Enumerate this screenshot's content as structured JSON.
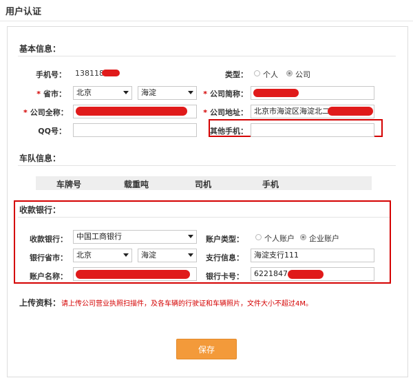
{
  "page": {
    "title": "用户认证"
  },
  "basic": {
    "title": "基本信息：",
    "phone": {
      "label": "手机号：",
      "value": "138118"
    },
    "type": {
      "label": "类型：",
      "options": [
        "个人",
        "公司"
      ],
      "selected": "公司"
    },
    "province": {
      "label": "省市：",
      "province": "北京",
      "city": "海淀"
    },
    "company_short": {
      "label": "公司简称："
    },
    "company_full": {
      "label": "公司全称："
    },
    "company_address": {
      "label": "公司地址：",
      "value": "北京市海淀区海淀北二"
    },
    "qq": {
      "label": "QQ号：",
      "value": ""
    },
    "other_phone": {
      "label": "其他手机：",
      "value": ""
    }
  },
  "fleet": {
    "title": "车队信息：",
    "columns": [
      "车牌号",
      "载重吨",
      "司机",
      "手机"
    ]
  },
  "bank": {
    "title": "收款银行：",
    "bank": {
      "label": "收款银行：",
      "value": "中国工商银行"
    },
    "account_type": {
      "label": "账户类型：",
      "options": [
        "个人账户",
        "企业账户"
      ],
      "selected": "企业账户"
    },
    "bank_province": {
      "label": "银行省市：",
      "province": "北京",
      "city": "海淀"
    },
    "branch": {
      "label": "支行信息：",
      "value": "海淀支行111"
    },
    "account_name": {
      "label": "账户名称："
    },
    "card_no": {
      "label": "银行卡号：",
      "value": "6221847"
    }
  },
  "upload": {
    "label": "上传资料：",
    "hint": "请上传公司营业执照扫描件，及各车辆的行驶证和车辆照片，文件大小不超过4M。"
  },
  "actions": {
    "save": "保存"
  },
  "colors": {
    "accent": "#f39a3a",
    "highlight": "#d40000",
    "redaction": "#e01a1a"
  },
  "marks": {
    "required": "*"
  }
}
